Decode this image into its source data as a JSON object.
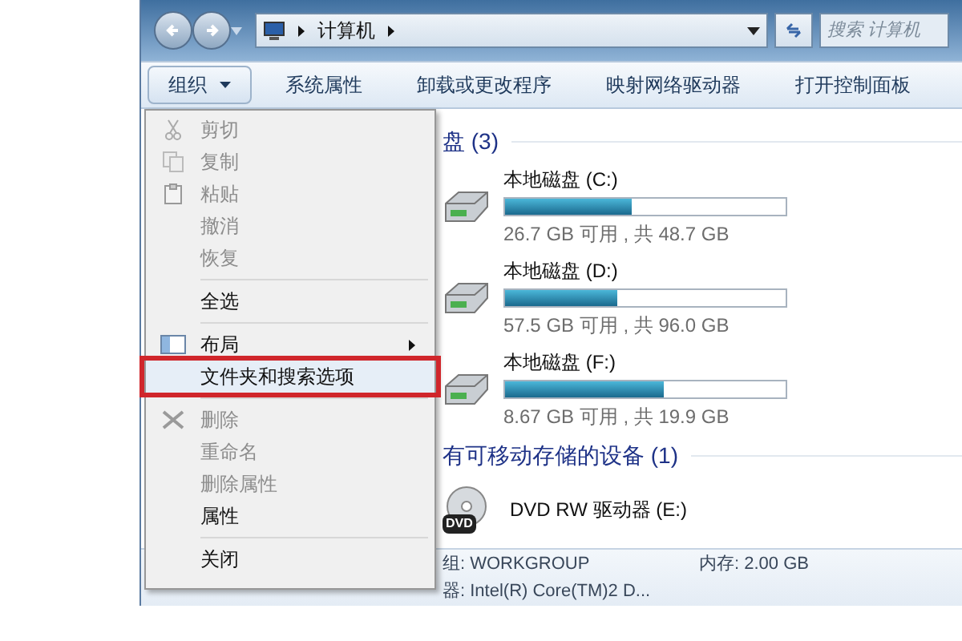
{
  "address_bar": {
    "path": [
      "计算机"
    ],
    "search_placeholder": "搜索 计算机"
  },
  "toolbar": [
    {
      "label": "组织",
      "dropdown": true,
      "pressed": true
    },
    {
      "label": "系统属性",
      "dropdown": false,
      "pressed": false
    },
    {
      "label": "卸载或更改程序",
      "dropdown": false,
      "pressed": false
    },
    {
      "label": "映射网络驱动器",
      "dropdown": false,
      "pressed": false
    },
    {
      "label": "打开控制面板",
      "dropdown": false,
      "pressed": false
    }
  ],
  "menu": [
    {
      "kind": "item",
      "label": "剪切",
      "disabled": true,
      "highlighted": false,
      "submenu": false
    },
    {
      "kind": "item",
      "label": "复制",
      "disabled": true,
      "highlighted": false,
      "submenu": false
    },
    {
      "kind": "item",
      "label": "粘贴",
      "disabled": true,
      "highlighted": false,
      "submenu": false
    },
    {
      "kind": "item",
      "label": "撤消",
      "disabled": true,
      "highlighted": false,
      "submenu": false
    },
    {
      "kind": "item",
      "label": "恢复",
      "disabled": true,
      "highlighted": false,
      "submenu": false
    },
    {
      "kind": "separator"
    },
    {
      "kind": "item",
      "label": "全选",
      "disabled": false,
      "highlighted": false,
      "submenu": false
    },
    {
      "kind": "separator"
    },
    {
      "kind": "item",
      "label": "布局",
      "disabled": false,
      "highlighted": false,
      "submenu": true
    },
    {
      "kind": "item",
      "label": "文件夹和搜索选项",
      "disabled": false,
      "highlighted": true,
      "submenu": false
    },
    {
      "kind": "separator"
    },
    {
      "kind": "item",
      "label": "删除",
      "disabled": true,
      "highlighted": false,
      "submenu": false
    },
    {
      "kind": "item",
      "label": "重命名",
      "disabled": true,
      "highlighted": false,
      "submenu": false
    },
    {
      "kind": "item",
      "label": "删除属性",
      "disabled": true,
      "highlighted": false,
      "submenu": false
    },
    {
      "kind": "item",
      "label": "属性",
      "disabled": false,
      "highlighted": false,
      "submenu": false
    },
    {
      "kind": "separator"
    },
    {
      "kind": "item",
      "label": "关闭",
      "disabled": false,
      "highlighted": false,
      "submenu": false
    }
  ],
  "sections": [
    {
      "heading": "盘 (3)",
      "items": [
        {
          "kind": "disk",
          "name": "本地磁盘 (C:)",
          "level": 0.45,
          "space": "26.7 GB 可用 , 共 48.7 GB"
        },
        {
          "kind": "disk",
          "name": "本地磁盘 (D:)",
          "level": 0.4,
          "space": "57.5 GB 可用 , 共 96.0 GB"
        },
        {
          "kind": "disk",
          "name": "本地磁盘 (F:)",
          "level": 0.565,
          "space": "8.67 GB 可用 , 共 19.9 GB"
        }
      ]
    },
    {
      "heading": "有可移动存储的设备 (1)",
      "items": [
        {
          "kind": "dvd",
          "name": "DVD RW 驱动器 (E:)",
          "badge": "DVD"
        }
      ]
    }
  ],
  "details": [
    {
      "label": "组: WORKGROUP",
      "value": "内存: 2.00 GB"
    },
    {
      "label": "器: Intel(R) Core(TM)2 D..."
    }
  ]
}
